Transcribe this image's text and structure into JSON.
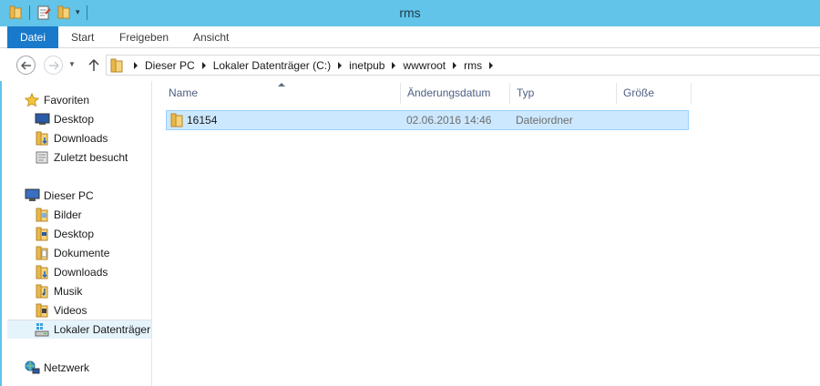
{
  "window": {
    "title": "rms",
    "accent_color": "#61c4e8"
  },
  "quick_access": {
    "icons": [
      "folder-icon",
      "properties-icon",
      "new-folder-icon"
    ],
    "dropdown": "▾"
  },
  "ribbon": {
    "tabs": [
      {
        "label": "Datei",
        "active": true
      },
      {
        "label": "Start"
      },
      {
        "label": "Freigeben"
      },
      {
        "label": "Ansicht"
      }
    ]
  },
  "address": {
    "breadcrumbs": [
      "Dieser PC",
      "Lokaler Datenträger (C:)",
      "inetpub",
      "wwwroot",
      "rms"
    ]
  },
  "nav_pane": {
    "favorites_label": "Favoriten",
    "favorites": [
      "Desktop",
      "Downloads",
      "Zuletzt besucht"
    ],
    "pc_label": "Dieser PC",
    "pc_items": [
      "Bilder",
      "Desktop",
      "Dokumente",
      "Downloads",
      "Musik",
      "Videos",
      "Lokaler Datenträger"
    ],
    "network_label": "Netzwerk"
  },
  "columns": {
    "name": "Name",
    "date": "Änderungsdatum",
    "type": "Typ",
    "size": "Größe"
  },
  "files": [
    {
      "name": "16154",
      "date": "02.06.2016 14:46",
      "type": "Dateiordner",
      "size": ""
    }
  ]
}
